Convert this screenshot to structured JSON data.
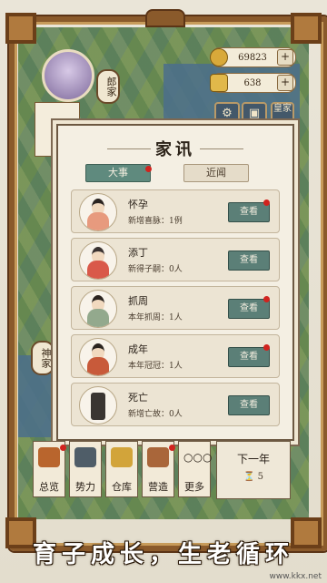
{
  "resources": {
    "coins": "69823",
    "ingots": "638"
  },
  "side_tags": {
    "left_top": "郎家",
    "left_bottom": "神家"
  },
  "top_right_tool": "皇家",
  "modal": {
    "title": "家讯",
    "tabs": [
      {
        "label": "大事"
      },
      {
        "label": "近闻"
      }
    ],
    "events": [
      {
        "title": "怀孕",
        "desc": "新增喜脉：1例",
        "button": "查看"
      },
      {
        "title": "添丁",
        "desc": "新得子嗣：0人",
        "button": "查看"
      },
      {
        "title": "抓周",
        "desc": "本年抓周：1人",
        "button": "查看"
      },
      {
        "title": "成年",
        "desc": "本年冠冠：1人",
        "button": "查看"
      },
      {
        "title": "死亡",
        "desc": "新增亡故：0人",
        "button": "查看"
      }
    ]
  },
  "bottom_nav": [
    {
      "label": "总览"
    },
    {
      "label": "势力"
    },
    {
      "label": "仓库"
    },
    {
      "label": "营造"
    },
    {
      "label": "更多"
    }
  ],
  "next_year": {
    "label": "下一年",
    "counter": "5"
  },
  "caption": "育子成长，生老循环",
  "watermark": "www.kkx.net",
  "colors": {
    "accent": "#5f8a7e",
    "frame": "#8a5a2b",
    "badge": "#d1231e"
  }
}
